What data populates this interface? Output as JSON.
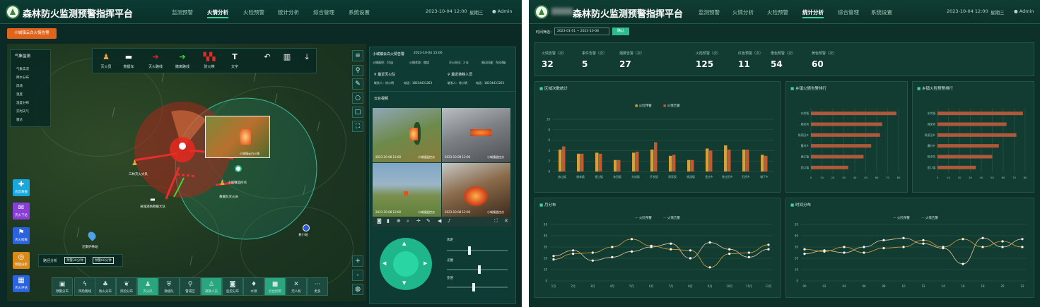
{
  "left": {
    "app_title": "森林防火监测预警指挥平台",
    "nav": [
      "监测预警",
      "火情分析",
      "火险预警",
      "统计分析",
      "综合管理",
      "系统设置"
    ],
    "datetime": "2023-10-04 12:00",
    "weekday": "星期三",
    "user": "Admin",
    "alert_button": "小城镇云白火情告警",
    "layer_panel": {
      "title": "气象监测",
      "items": [
        "气象实况",
        "降水分布",
        "风场",
        "温度",
        "湿度分布",
        "实时天气",
        "雷达"
      ]
    },
    "toolbar": [
      "灭火员",
      "救援车",
      "灭火路线",
      "撤离路线",
      "防火带",
      "文字"
    ],
    "map_labels": {
      "popup": "小城镇云白火情",
      "team1": "三林灭火大队",
      "team2": "县城消防救援大队",
      "team3": "救援队灭火员",
      "point": "小城镇监控点",
      "base": "汪家护林站",
      "station": "县小站"
    },
    "left_tools": [
      "应急救援",
      "灭火下达",
      "灭火指挥",
      "智能分析",
      "灭火评估"
    ],
    "map_footer": {
      "label": "路径分析",
      "btn1": "预警30分钟",
      "btn2": "预警60分钟"
    },
    "bottom_tools": [
      "预警分布",
      "风险路线",
      "防火分布",
      "风险分布",
      "灭火队",
      "救援队",
      "警戒区",
      "疏散人员",
      "监控分布",
      "水源",
      "云台控制",
      "无人机",
      "更多"
    ],
    "info": {
      "title": "小城镇云白火情告警",
      "time": "2023-10-04 15:00",
      "l1": "火情面积：10亩",
      "l2": "火情状态：燃烧",
      "l3": "灭火队伍：3 支",
      "l4": "周边风速：东风4级",
      "team_label": "最近灭火队",
      "team_contact": "联系人：徐小明",
      "team_phone": "电话：18234431263",
      "person_label": "最近转移人员",
      "person_contact": "联系人：徐小明",
      "person_phone": "电话：18234431263"
    },
    "camera_title": "云台视频",
    "cams": [
      {
        "label": "小城镇监控点",
        "time": "2023-10-08 12:00",
        "pal": "#8b7a3a"
      },
      {
        "label": "小城镇监控点",
        "time": "2023-10-08 12:00",
        "pal": "#5a5f63"
      },
      {
        "label": "小城镇监控点",
        "time": "2023-10-08 12:00",
        "pal": "#4e6d8e"
      },
      {
        "label": "小城镇监控点",
        "time": "2023-10-08 12:00",
        "pal": "#6a3a22"
      }
    ],
    "controls": {
      "s1": "焦距",
      "s2": "光圈",
      "s3": "变倍"
    }
  },
  "right": {
    "app_title": "森林防火监测预警指挥平台",
    "nav": [
      "监测预警",
      "火情分析",
      "火险预警",
      "统计分析",
      "综合管理",
      "系统设置"
    ],
    "datetime": "2023-10-04 12:00",
    "weekday": "星期三",
    "user": "Admin",
    "filter_label": "时间筛选：",
    "range": "2023-01-01 ~ 2023-10-08",
    "confirm": "确认",
    "stats": [
      {
        "label": "火情告警（次）",
        "value": "32"
      },
      {
        "label": "事件告警（次）",
        "value": "5"
      },
      {
        "label": "烟雾告警（次）",
        "value": "27"
      },
      {
        "label": "火险预警（次）",
        "value": "125"
      },
      {
        "label": "红色预警（次）",
        "value": "11"
      },
      {
        "label": "橙色预警（次）",
        "value": "54"
      },
      {
        "label": "黄色预警（次）",
        "value": "60"
      }
    ],
    "card1": "区域次数统计",
    "card2": "乡镇火情告警排行",
    "card3": "乡镇火险预警排行",
    "card4": "月分布",
    "card5": "时间分布",
    "legend_warn": "火险预警",
    "legend_fire": "火情告警"
  },
  "chart_data": [
    {
      "type": "bar",
      "title": "区域次数统计",
      "categories": [
        "曲山镇",
        "桃林镇",
        "望江镇",
        "朱田镇",
        "东岗镇",
        "开发镇",
        "周家镇",
        "桃溪镇",
        "皇庄乡",
        "陈庄田乡",
        "石桥乡",
        "城下乡"
      ],
      "series": [
        {
          "name": "火险预警",
          "color": "#d9a03a",
          "values": [
            4.2,
            3.4,
            3.6,
            2.2,
            3.6,
            4.2,
            3.0,
            2.2,
            4.4,
            5.0,
            4.2,
            3.2
          ]
        },
        {
          "name": "火情告警",
          "color": "#c8562f",
          "values": [
            4.8,
            3.4,
            3.4,
            2.2,
            3.8,
            5.6,
            3.2,
            2.2,
            4.0,
            4.2,
            4.2,
            3.0
          ]
        }
      ],
      "ylim": [
        0,
        10
      ]
    },
    {
      "type": "bar",
      "title": "乡镇火情告警排行",
      "orientation": "horizontal",
      "categories": [
        "东岗镇",
        "蔺家桥",
        "陈家田乡",
        "曹村乡",
        "周庄镇",
        "团口镇"
      ],
      "values": [
        78,
        65,
        63,
        55,
        48,
        34
      ],
      "xlim": [
        0,
        80
      ]
    },
    {
      "type": "bar",
      "title": "乡镇火险预警排行",
      "orientation": "horizontal",
      "categories": [
        "东岗镇",
        "周家桥",
        "陈家田乡",
        "曹村乡",
        "阳寺院",
        "团口镇"
      ],
      "values": [
        78,
        63,
        72,
        56,
        50,
        35
      ],
      "xlim": [
        0,
        80
      ]
    },
    {
      "type": "line",
      "title": "月分布",
      "x": [
        "1月",
        "2月",
        "3月",
        "4月",
        "5月",
        "6月",
        "7月",
        "8月",
        "9月",
        "10月",
        "11月",
        "12月"
      ],
      "series": [
        {
          "name": "火险预警",
          "values": [
            22,
            27,
            18,
            21,
            26,
            30,
            33,
            20,
            34,
            28,
            21,
            28
          ]
        },
        {
          "name": "火情告警",
          "values": [
            19,
            24,
            25,
            30,
            37,
            31,
            28,
            27,
            12,
            24,
            25,
            32
          ]
        }
      ],
      "ylim": [
        0,
        50
      ]
    },
    {
      "type": "line",
      "title": "时间分布",
      "x": [
        "00",
        "02",
        "04",
        "06",
        "08",
        "10",
        "12",
        "14",
        "16",
        "18",
        "20",
        "22"
      ],
      "series": [
        {
          "name": "火险预警",
          "values": [
            24,
            27,
            25,
            30,
            36,
            38,
            33,
            29,
            15,
            38,
            30,
            37
          ]
        },
        {
          "name": "火情告警",
          "values": [
            28,
            26,
            30,
            25,
            29,
            30,
            36,
            30,
            37,
            30,
            35,
            30
          ]
        }
      ],
      "ylim": [
        0,
        50
      ]
    }
  ]
}
